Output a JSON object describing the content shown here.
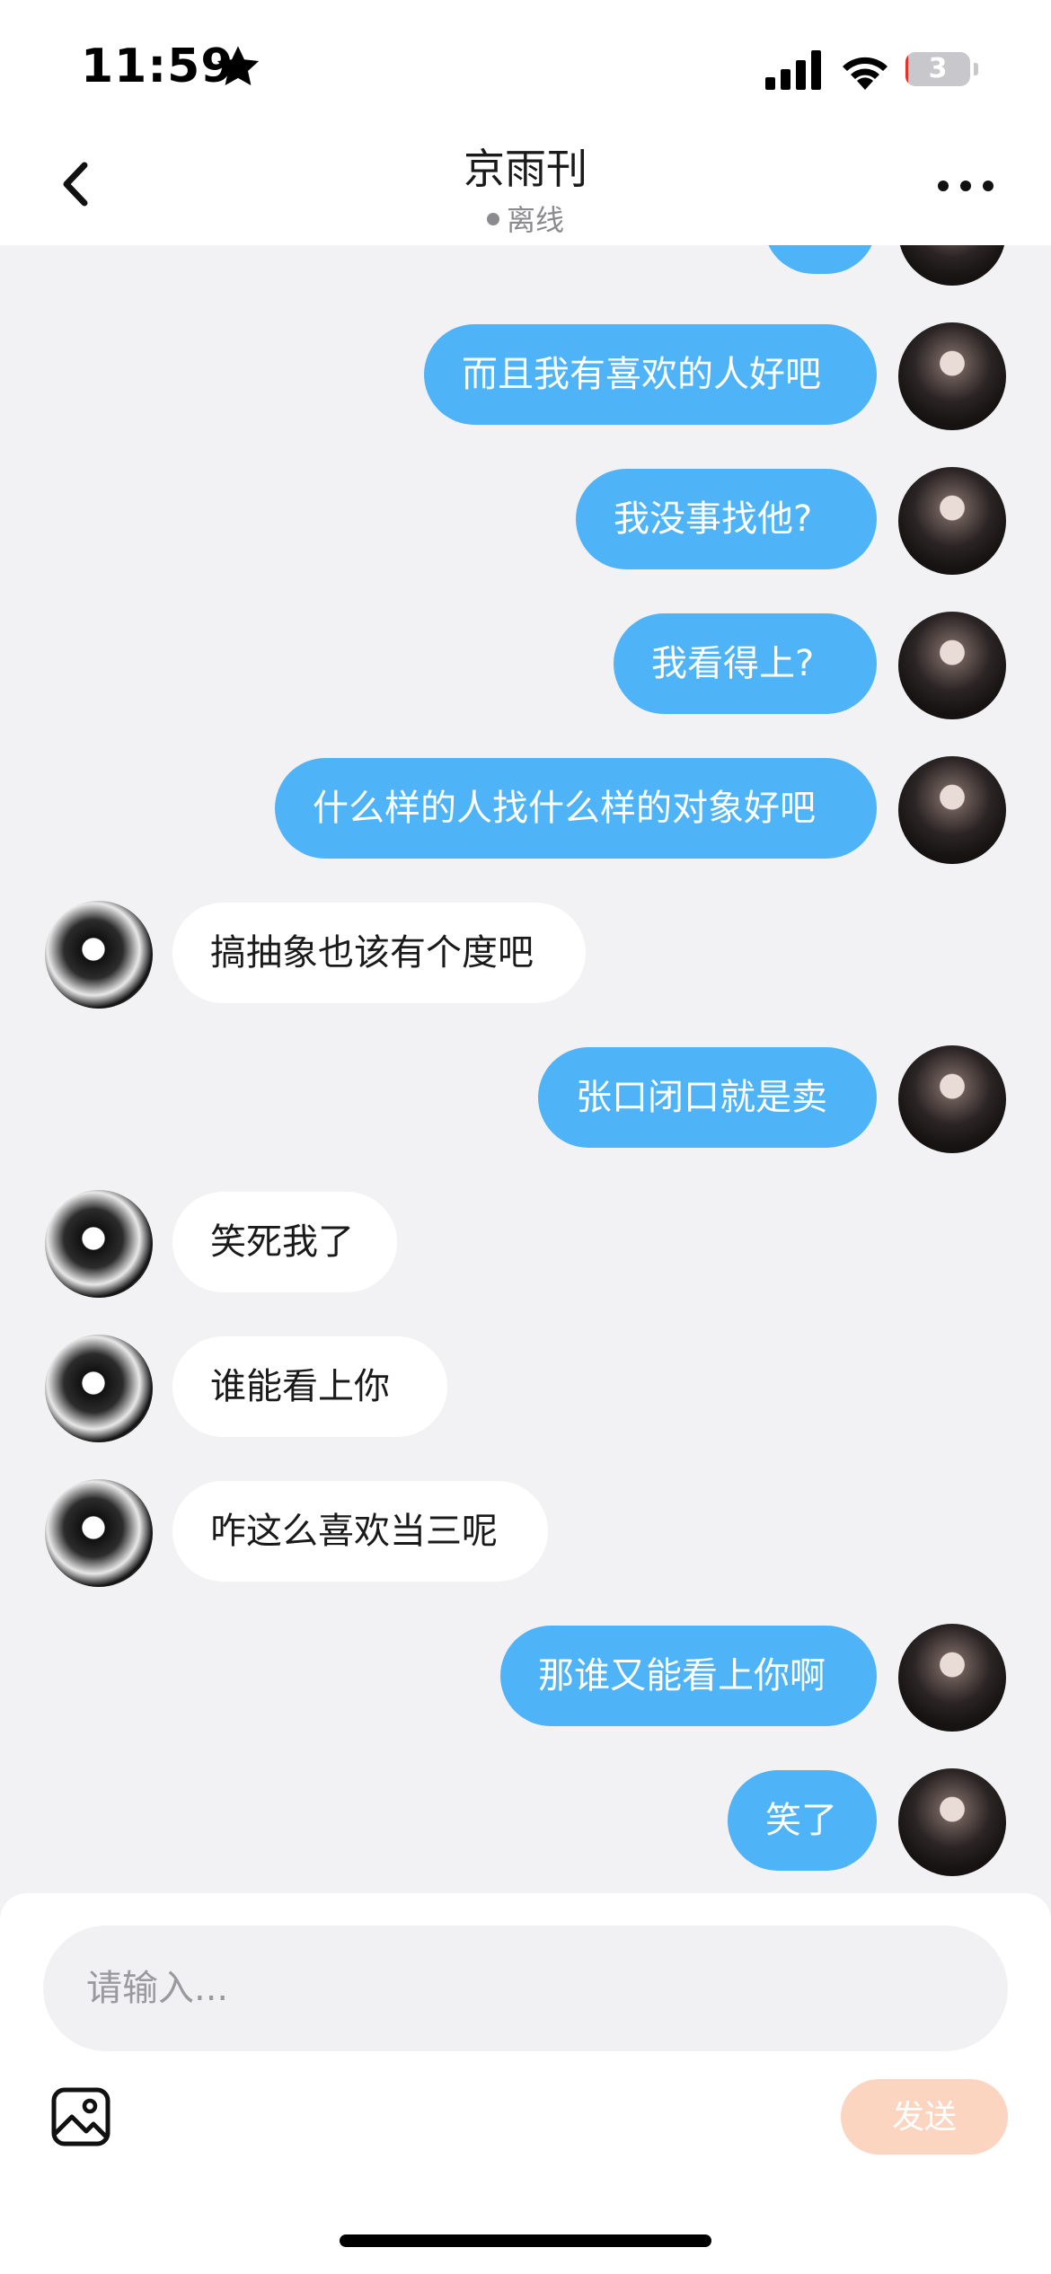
{
  "status_bar": {
    "time": "11:59",
    "battery_level": "3",
    "battery_fill_pct": 4,
    "icons": [
      "star-icon",
      "cellular-signal-icon",
      "wifi-icon",
      "battery-icon"
    ]
  },
  "header": {
    "title": "京雨刊",
    "presence": "离线",
    "icons": [
      "back-chevron-icon",
      "more-dots-icon"
    ]
  },
  "messages": [
    {
      "side": "me",
      "text": ""
    },
    {
      "side": "me",
      "text": "而且我有喜欢的人好吧"
    },
    {
      "side": "me",
      "text": "我没事找他?"
    },
    {
      "side": "me",
      "text": "我看得上?"
    },
    {
      "side": "me",
      "text": "什么样的人找什么样的对象好吧"
    },
    {
      "side": "them",
      "text": "搞抽象也该有个度吧"
    },
    {
      "side": "me",
      "text": "张口闭口就是卖"
    },
    {
      "side": "them",
      "text": "笑死我了"
    },
    {
      "side": "them",
      "text": "谁能看上你"
    },
    {
      "side": "them",
      "text": "咋这么喜欢当三呢"
    },
    {
      "side": "me",
      "text": "那谁又能看上你啊"
    },
    {
      "side": "me",
      "text": "笑了"
    }
  ],
  "composer": {
    "placeholder": "请输入...",
    "value": "",
    "send_label": "发送",
    "image_icon": "image-icon"
  },
  "colors": {
    "my_bubble": "#4fb4f7",
    "their_bubble": "#ffffff",
    "background": "#f2f2f4",
    "send_button": "#fcd5c1",
    "battery_low": "#e5332a"
  }
}
